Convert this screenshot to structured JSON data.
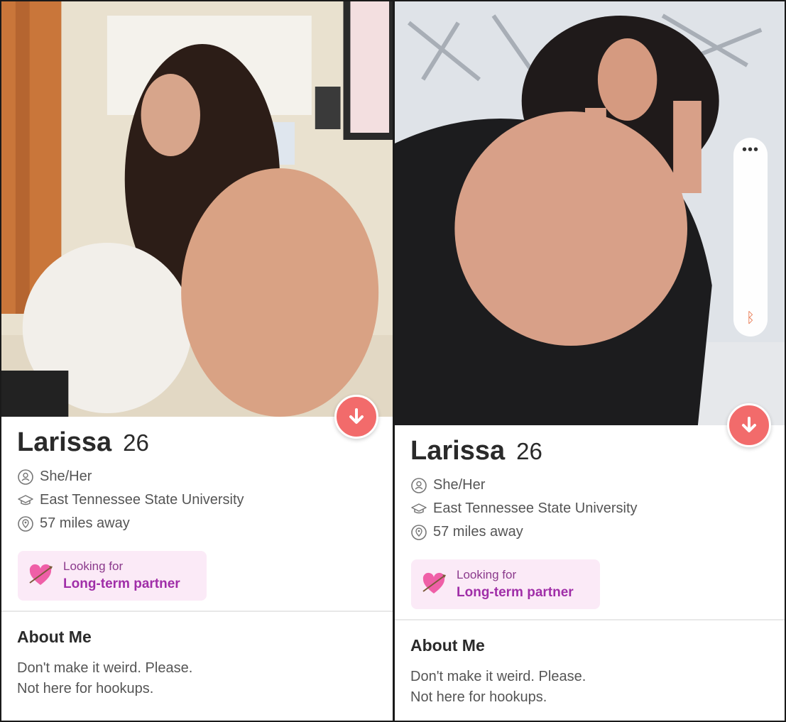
{
  "profiles": [
    {
      "name": "Larissa",
      "age": "26",
      "pronouns": "She/Her",
      "school": "East Tennessee State University",
      "distance": "57 miles away",
      "looking_for_label": "Looking for",
      "looking_for_value": "Long-term partner",
      "about_title": "About Me",
      "about_text": "Don't make it weird. Please.\nNot here for hookups."
    },
    {
      "name": "Larissa",
      "age": "26",
      "pronouns": "She/Her",
      "school": "East Tennessee State University",
      "distance": "57 miles away",
      "looking_for_label": "Looking for",
      "looking_for_value": "Long-term partner",
      "about_title": "About Me",
      "about_text": "Don't make it weird. Please.\nNot here for hookups."
    }
  ],
  "icons": {
    "pronoun": "person-circle-icon",
    "school": "graduation-cap-icon",
    "location": "location-pin-icon",
    "looking": "heart-arrow-icon",
    "expand": "arrow-down-icon",
    "more": "more-dots-icon",
    "bluetooth": "bluetooth-icon"
  },
  "colors": {
    "accent": "#f26b6b",
    "looking_bg": "#fbeaf7",
    "looking_text": "#a02ea8"
  }
}
